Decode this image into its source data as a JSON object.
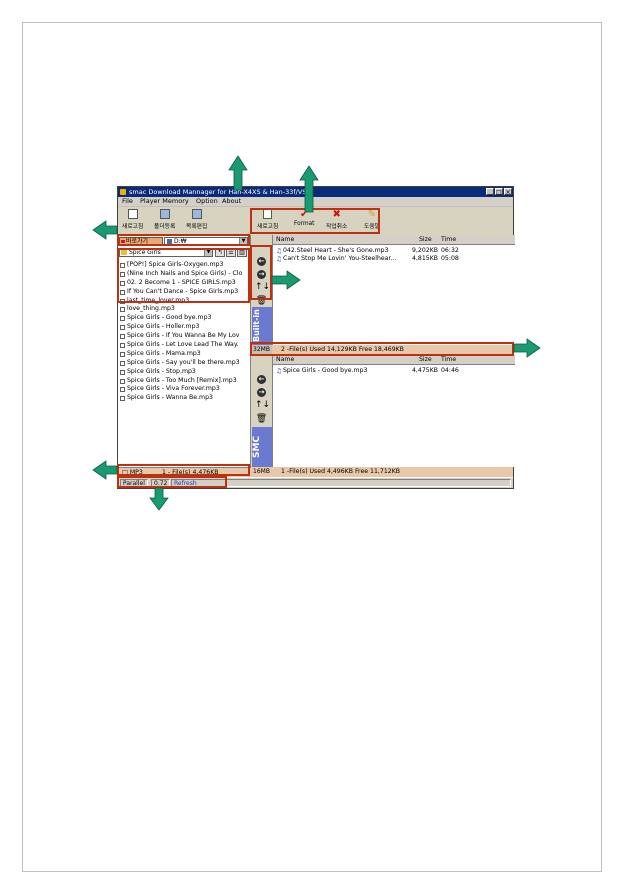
{
  "window": {
    "title": "smac Download Mannager for Han-X",
    "title_tail": "4XS & Han-33f/VS",
    "controls": [
      "_",
      "□",
      "×"
    ]
  },
  "menu": [
    "File",
    "Player Memory",
    "Option",
    "About"
  ],
  "toolbar_left": {
    "items": [
      {
        "label": "새로고침",
        "icon": "refresh-icon"
      },
      {
        "label": "폴더등록",
        "icon": "folder-register-icon"
      },
      {
        "label": "목록편집",
        "icon": "list-edit-icon"
      }
    ]
  },
  "toolbar_right": {
    "items": [
      {
        "label": "새로고침",
        "icon": "refresh-icon"
      },
      {
        "label": "Format",
        "icon": "check-icon"
      },
      {
        "label": "작업취소",
        "icon": "cancel-icon"
      },
      {
        "label": "도움말",
        "icon": "help-icon"
      }
    ]
  },
  "left_pane": {
    "goto_label": "바로가기",
    "drive_value": "D:₩",
    "folder_value": "Spice Girls",
    "files": [
      "[POP!] Spice Girls-Oxygen.mp3",
      "(Nine Inch Nails and Spice Girls) - Clo",
      "02. 2 Become 1 - SPICE GIRLS.mp3",
      "If You Can't Dance - Spice Girls.mp3",
      "last_time_lover.mp3",
      "love_thing.mp3",
      "Spice Girls - Good bye.mp3",
      "Spice Girls - Holler.mp3",
      "Spice Girls - If You Wanna Be My Lov",
      "Spice Girls - Let Love Lead The Way.",
      "Spice Girls - Mama.mp3",
      "Spice Girls - Say you'll be there.mp3",
      "Spice Girls - Stop.mp3",
      "Spice Girls - Too Much [Remix].mp3",
      "Spice Girls - Viva Forever.mp3",
      "Spice Girls - Wanna Be.mp3"
    ],
    "status_type": "MP3",
    "status_text": "1 - File(s)   4,476KB"
  },
  "bottom_bar": {
    "mode": "Parallel",
    "version": "0.72",
    "refresh": "Refresh"
  },
  "builtin": {
    "label": "Built-in",
    "size": "32MB",
    "columns": {
      "name": "Name",
      "size": "Size",
      "time": "Time"
    },
    "files": [
      {
        "name": "042.Steel Heart - She's Gone.mp3",
        "size": "9,202KB",
        "time": "06:32"
      },
      {
        "name": "Can't Stop Me Lovin' You-Steelhear...",
        "size": "4,815KB",
        "time": "05:08"
      }
    ],
    "status": "2 -File(s)  Used 14,129KB   Free 18,469KB"
  },
  "smc": {
    "label": "SMC",
    "size": "16MB",
    "columns": {
      "name": "Name",
      "size": "Size",
      "time": "Time"
    },
    "files": [
      {
        "name": "Spice Girls - Good bye.mp3",
        "size": "4,475KB",
        "time": "04:46"
      }
    ],
    "status": "1 -File(s)  Used 4,496KB   Free 11,712KB"
  },
  "mid_controls": [
    "←",
    "→",
    "↑↓",
    "🗑"
  ],
  "colors": {
    "highlight": "#c03010",
    "arrow": "#1a9a70",
    "builtin_band": "#6a7ad0",
    "status_band": "#e8c8a8"
  }
}
